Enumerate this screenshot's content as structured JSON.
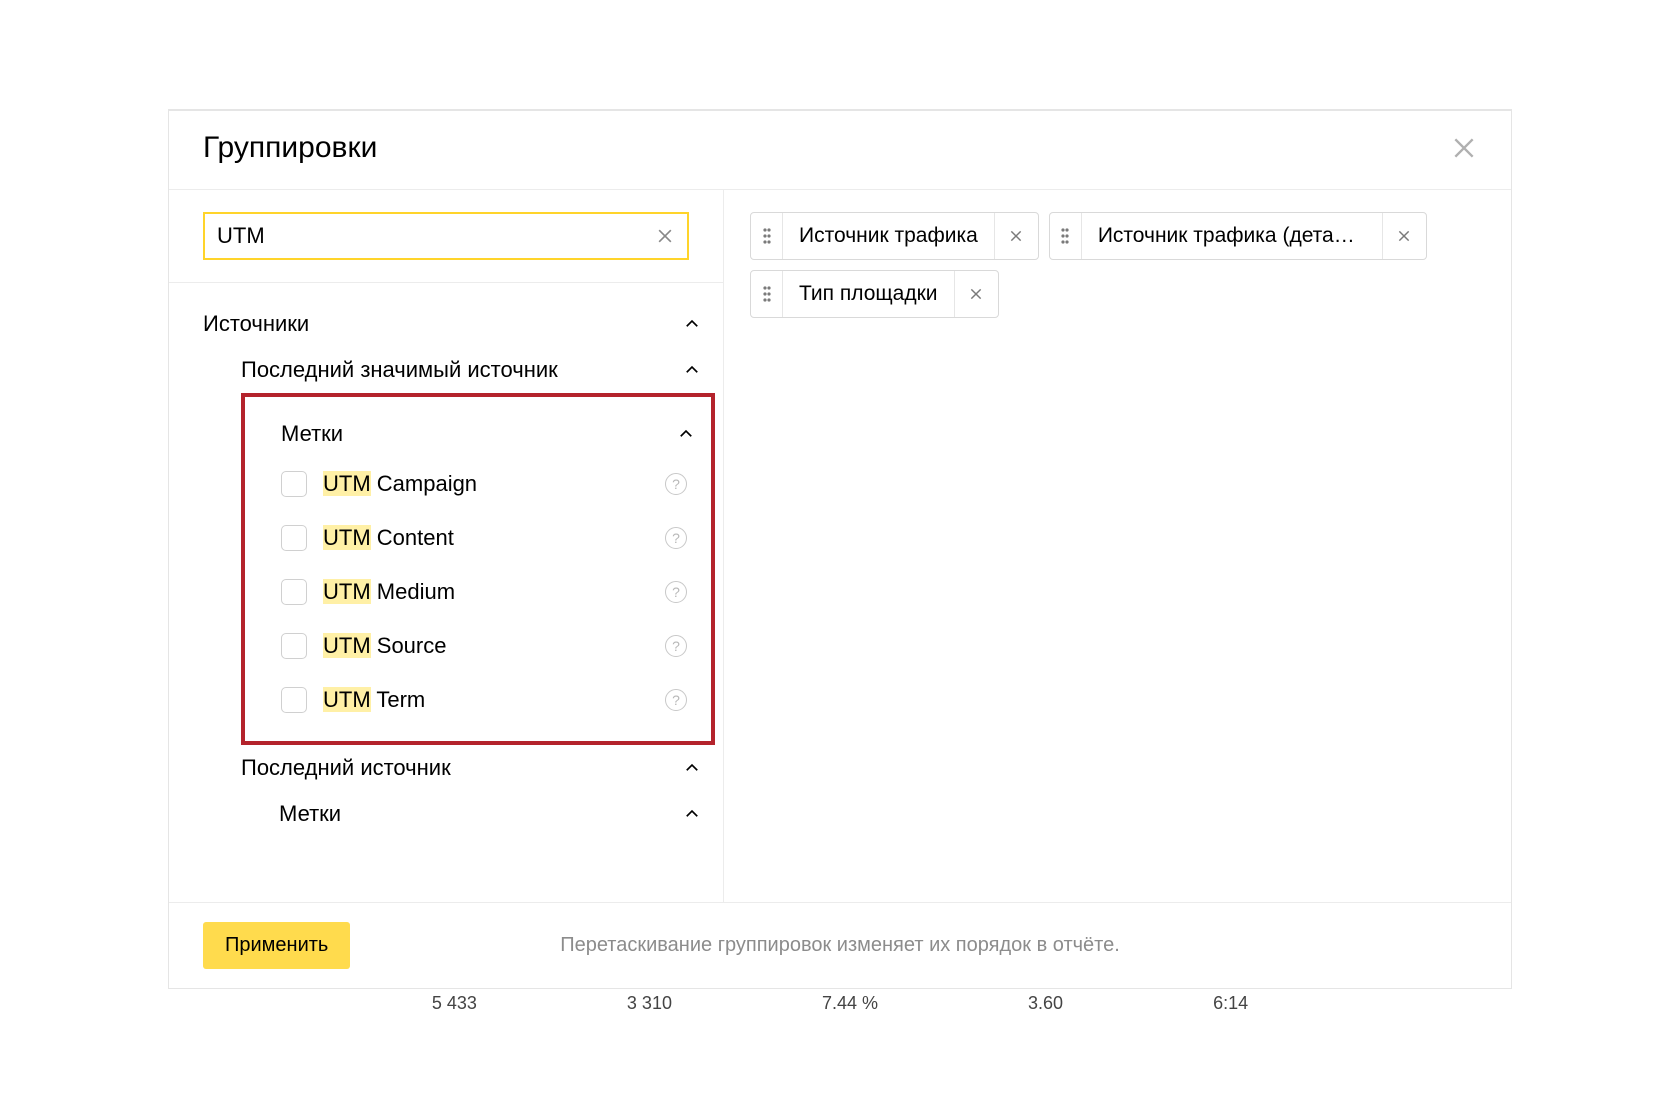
{
  "header": {
    "title": "Группировки"
  },
  "search": {
    "value": "UTM"
  },
  "tree": {
    "cat1": {
      "label": "Источники"
    },
    "subcat1": {
      "label": "Последний значимый источник"
    },
    "metki1": {
      "label": "Метки"
    },
    "items": [
      {
        "hl": "UTM",
        "rest": " Campaign"
      },
      {
        "hl": "UTM",
        "rest": " Content"
      },
      {
        "hl": "UTM",
        "rest": " Medium"
      },
      {
        "hl": "UTM",
        "rest": " Source"
      },
      {
        "hl": "UTM",
        "rest": " Term"
      }
    ],
    "subcat2": {
      "label": "Последний источник"
    },
    "metki2": {
      "label": "Метки"
    }
  },
  "chips": [
    {
      "label": "Источник трафика"
    },
    {
      "label": "Источник трафика (деталь..."
    },
    {
      "label": "Тип площадки"
    }
  ],
  "footer": {
    "apply": "Применить",
    "hint": "Перетаскивание группировок изменяет их порядок в отчёте."
  },
  "bottom": [
    "5 433",
    "3 310",
    "7.44 %",
    "3.60",
    "6:14"
  ]
}
